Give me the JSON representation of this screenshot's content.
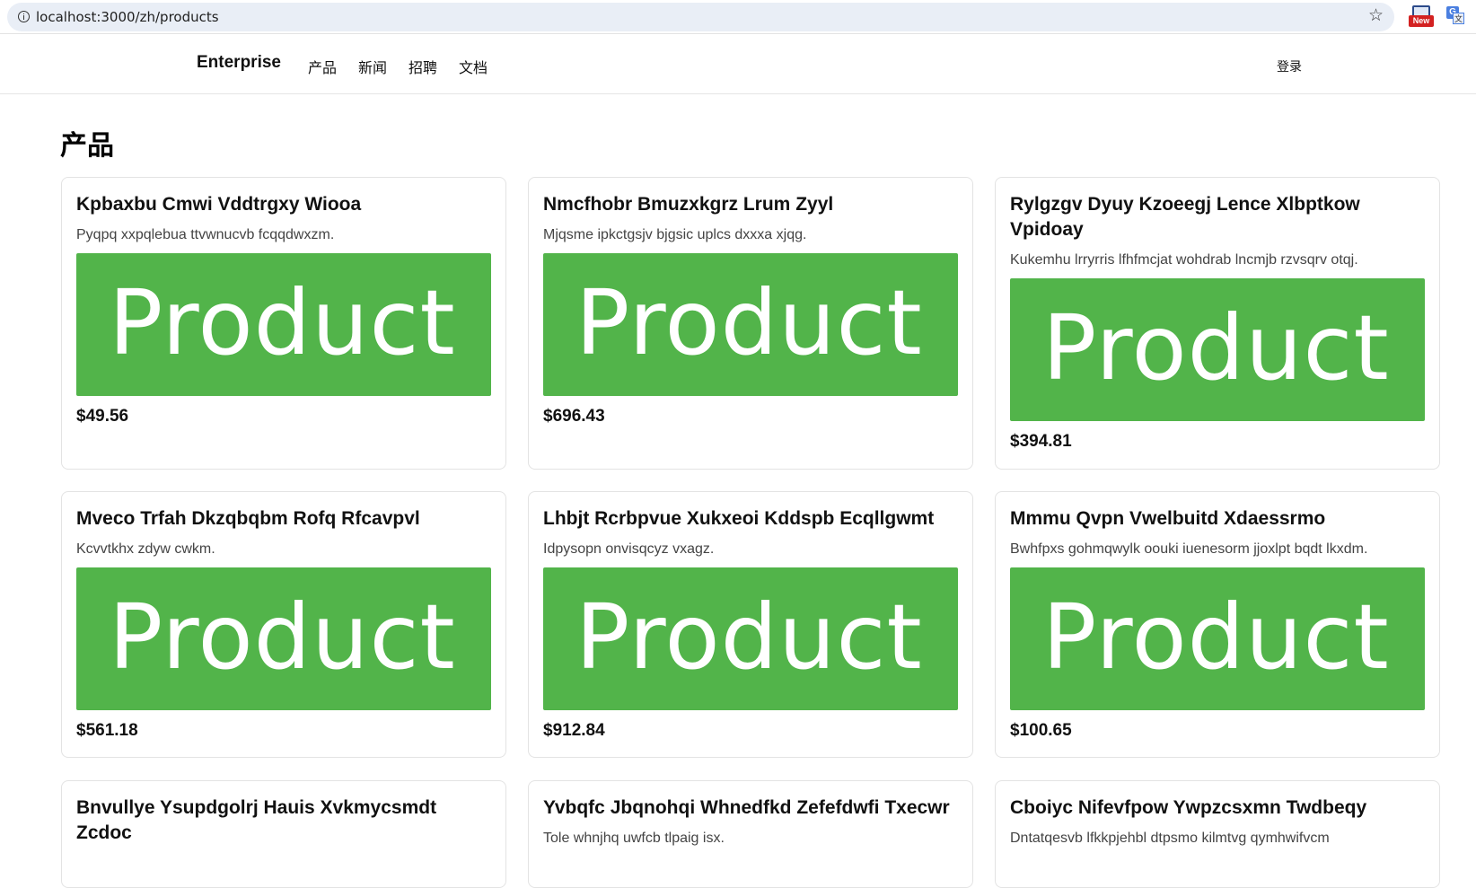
{
  "browser": {
    "url": "localhost:3000/zh/products",
    "new_badge": "New",
    "translate_glyph_a": "G",
    "translate_glyph_b": "文"
  },
  "header": {
    "brand": "Enterprise",
    "nav": [
      "产品",
      "新闻",
      "招聘",
      "文档"
    ],
    "login": "登录"
  },
  "page": {
    "title": "产品"
  },
  "colors": {
    "product_image": "#52b44a",
    "border": "#e3e3e3"
  },
  "products": [
    {
      "title": "Kpbaxbu Cmwi Vddtrgxy Wiooa",
      "description": "Pyqpq xxpqlebua ttvwnucvb fcqqdwxzm.",
      "image_text": "Product",
      "price": "$49.56"
    },
    {
      "title": "Nmcfhobr Bmuzxkgrz Lrum Zyyl",
      "description": "Mjqsme ipkctgsjv bjgsic uplcs dxxxa xjqg.",
      "image_text": "Product",
      "price": "$696.43"
    },
    {
      "title": "Rylgzgv Dyuy Kzoeegj Lence Xlbptkow Vpidoay",
      "description": "Kukemhu lrryrris lfhfmcjat wohdrab lncmjb rzvsqrv otqj.",
      "image_text": "Product",
      "price": "$394.81"
    },
    {
      "title": "Mveco Trfah Dkzqbqbm Rofq Rfcavpvl",
      "description": "Kcvvtkhx zdyw cwkm.",
      "image_text": "Product",
      "price": "$561.18"
    },
    {
      "title": "Lhbjt Rcrbpvue Xukxeoi Kddspb Ecqllgwmt",
      "description": "Idpysopn onvisqcyz vxagz.",
      "image_text": "Product",
      "price": "$912.84"
    },
    {
      "title": "Mmmu Qvpn Vwelbuitd Xdaessrmo",
      "description": "Bwhfpxs gohmqwylk oouki iuenesorm jjoxlpt bqdt lkxdm.",
      "image_text": "Product",
      "price": "$100.65"
    },
    {
      "title": "Bnvullye Ysupdgolrj Hauis Xvkmycsmdt Zcdoc",
      "description": "",
      "image_text": "",
      "price": ""
    },
    {
      "title": "Yvbqfc Jbqnohqi Whnedfkd Zefefdwfi Txecwr",
      "description": "Tole whnjhq uwfcb tlpaig isx.",
      "image_text": "",
      "price": ""
    },
    {
      "title": "Cboiyc Nifevfpow Ywpzcsxmn Twdbeqy",
      "description": "Dntatqesvb lfkkpjehbl dtpsmo kilmtvg qymhwifvcm",
      "image_text": "",
      "price": ""
    }
  ]
}
